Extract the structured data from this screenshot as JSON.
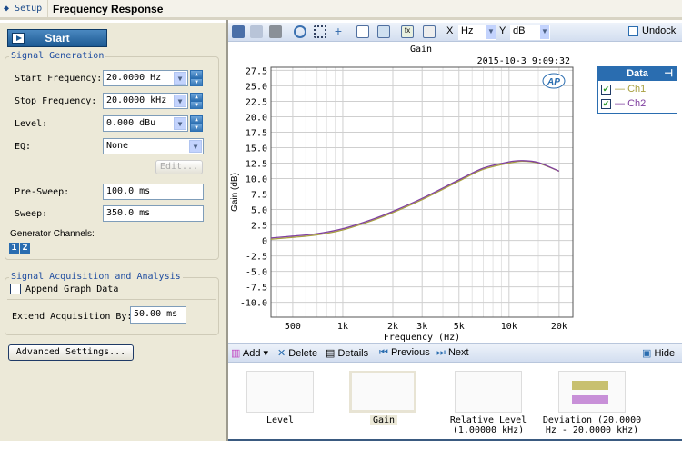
{
  "topbar": {
    "back": "Setup",
    "title": "Frequency Response"
  },
  "left": {
    "start": "Start",
    "signal_generation": {
      "title": "Signal Generation",
      "start_frequency": {
        "label": "Start Frequency:",
        "value": "20.0000 Hz"
      },
      "stop_frequency": {
        "label": "Stop Frequency:",
        "value": "20.0000 kHz"
      },
      "level": {
        "label": "Level:",
        "value": "0.000 dBu"
      },
      "eq": {
        "label": "EQ:",
        "value": "None"
      },
      "edit": "Edit...",
      "pre_sweep": {
        "label": "Pre-Sweep:",
        "value": "100.0 ms"
      },
      "sweep": {
        "label": "Sweep:",
        "value": "350.0 ms"
      },
      "generator_channels": "Generator Channels:",
      "channels": [
        "1",
        "2"
      ]
    },
    "acquisition": {
      "title": "Signal Acquisition and Analysis",
      "append": "Append Graph Data",
      "append_checked": false,
      "extend": {
        "label": "Extend Acquisition By:",
        "value": "50.00 ms"
      }
    },
    "advanced": "Advanced Settings..."
  },
  "toolbar": {
    "x_label": "X",
    "x_unit": "Hz",
    "y_label": "Y",
    "y_unit": "dB",
    "undock": "Undock"
  },
  "chart_data": {
    "type": "line",
    "title": "Gain",
    "timestamp": "2015-10-3 9:09:32",
    "xlabel": "Frequency (Hz)",
    "ylabel": "Gain (dB)",
    "xscale": "log",
    "xlim": [
      370,
      24200
    ],
    "ylim": [
      -12.4,
      28
    ],
    "xticks": [
      500,
      1000,
      2000,
      3000,
      5000,
      10000,
      20000
    ],
    "xtick_labels": [
      "500",
      "1k",
      "2k",
      "3k",
      "5k",
      "10k",
      "20k"
    ],
    "yticks": [
      27.5,
      25,
      22.5,
      20,
      17.5,
      15,
      12.5,
      10,
      7.5,
      5,
      2.5,
      0,
      -2.5,
      -5,
      -7.5,
      -10
    ],
    "ytick_labels": [
      "27.5",
      "25.0",
      "22.5",
      "20.0",
      "17.5",
      "15.0",
      "12.5",
      "10.0",
      "7.5",
      "5.0",
      "2.5",
      "0",
      "-2.5",
      "-5.0",
      "-7.5",
      "-10.0"
    ],
    "grid": true,
    "x": [
      370,
      500,
      700,
      1000,
      1500,
      2000,
      3000,
      5000,
      7000,
      10000,
      12000,
      15000,
      20000
    ],
    "series": [
      {
        "name": "Ch1",
        "color": "#a8a040",
        "values": [
          0.2,
          0.5,
          0.9,
          1.7,
          3.2,
          4.5,
          6.6,
          9.6,
          11.5,
          12.5,
          12.8,
          12.5,
          11.2
        ]
      },
      {
        "name": "Ch2",
        "color": "#8040a0",
        "values": [
          0.4,
          0.7,
          1.1,
          1.9,
          3.4,
          4.7,
          6.8,
          9.8,
          11.7,
          12.7,
          12.9,
          12.6,
          11.2
        ]
      }
    ],
    "legend": {
      "title": "Data",
      "placement": "right"
    }
  },
  "bottom_toolbar": {
    "add": "Add",
    "delete": "Delete",
    "details": "Details",
    "previous": "Previous",
    "next": "Next",
    "hide": "Hide"
  },
  "thumbnails": [
    {
      "label": "Level"
    },
    {
      "label": "Gain",
      "selected": true
    },
    {
      "label": "Relative Level (1.00000 kHz)"
    },
    {
      "label": "Deviation (20.0000 Hz - 20.0000 kHz)"
    }
  ]
}
